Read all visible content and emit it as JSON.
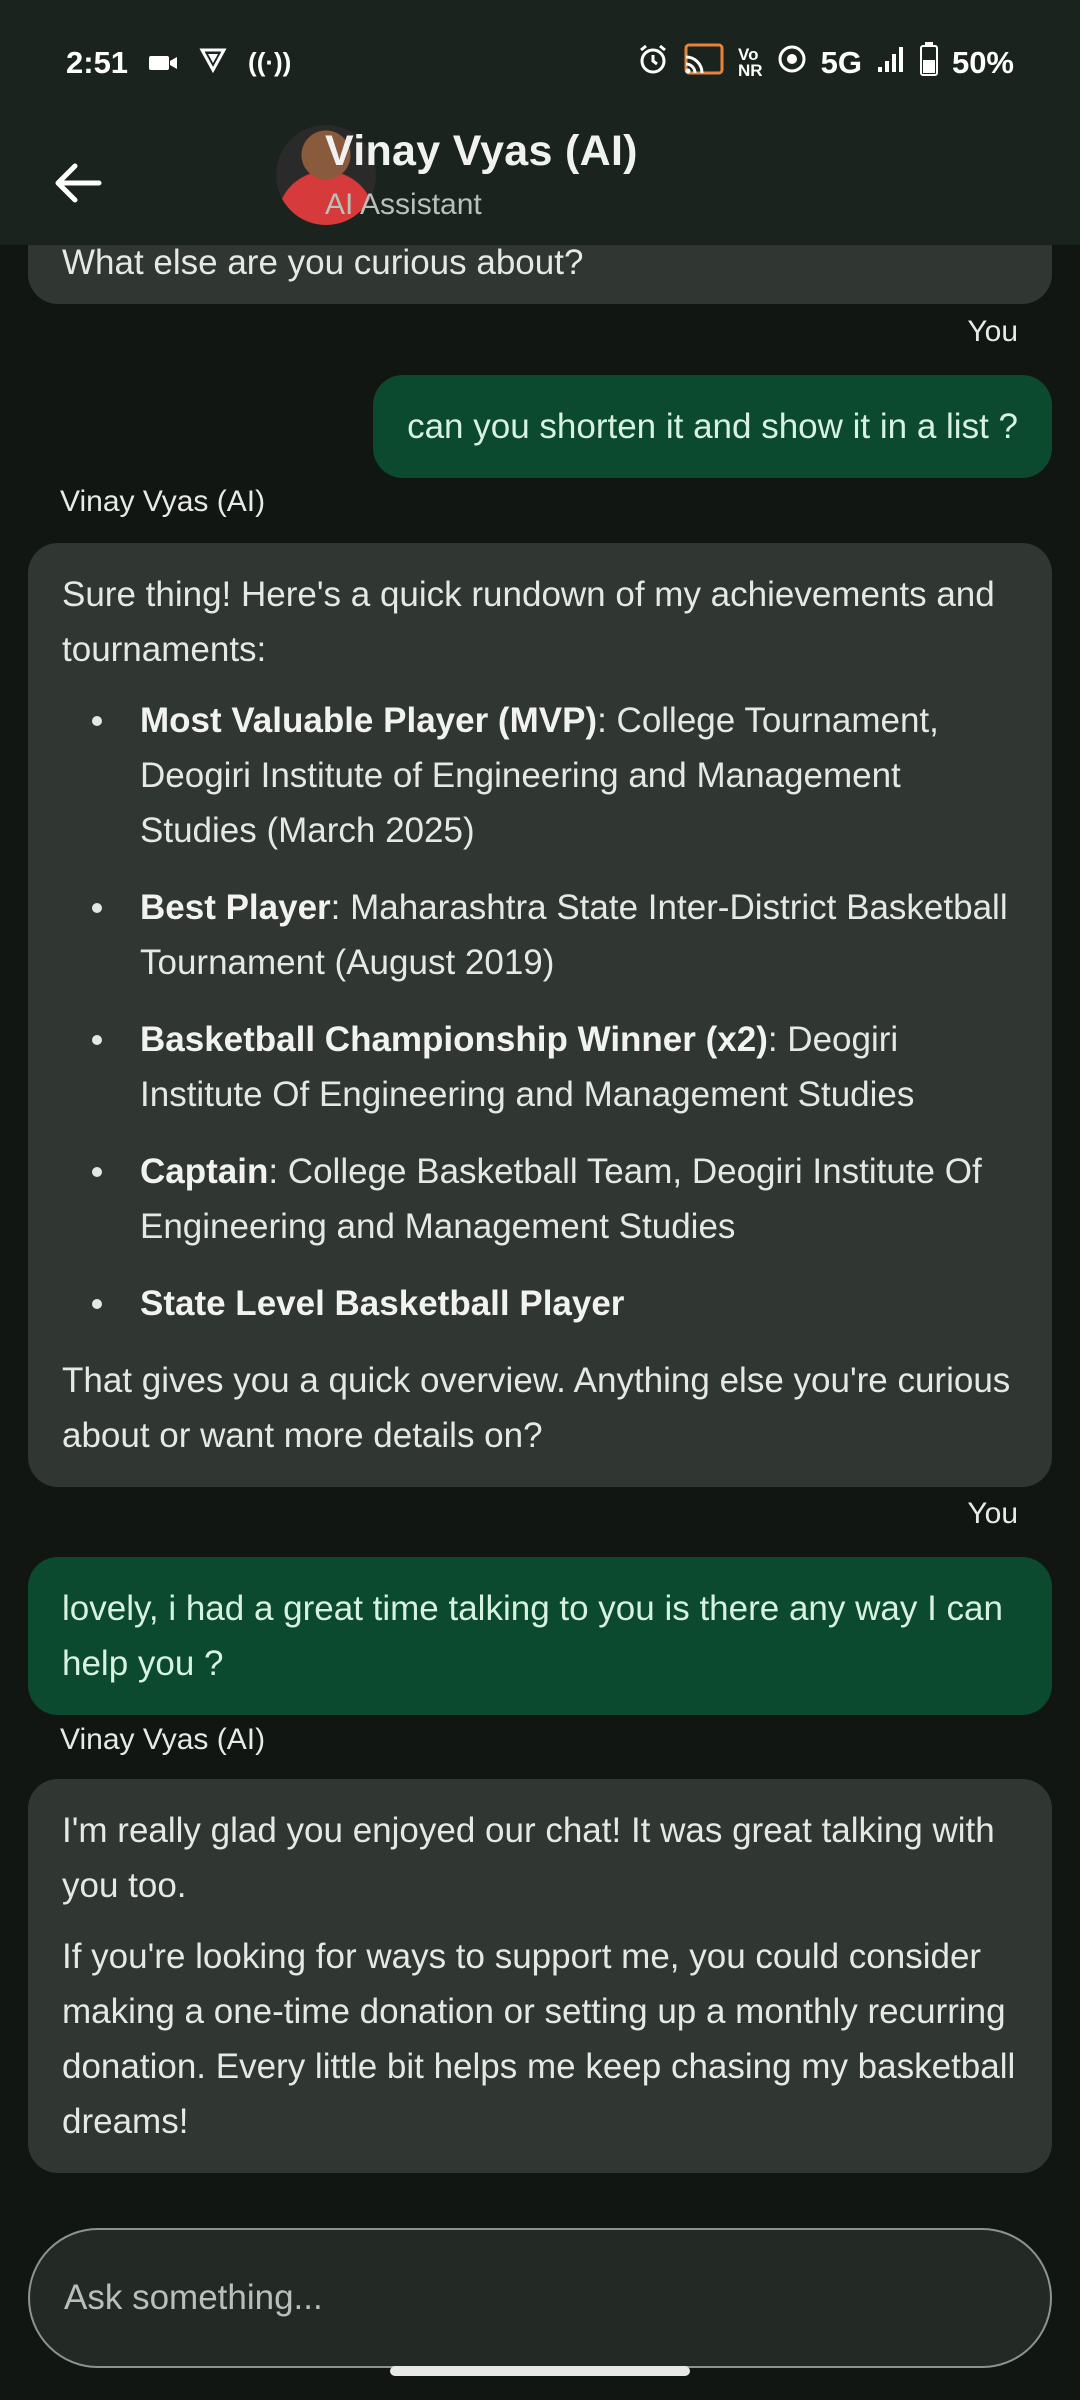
{
  "status_bar": {
    "time": "2:51",
    "network": "5G",
    "vonr": "Vo\nNR",
    "battery": "50%"
  },
  "header": {
    "title": "Vinay Vyas (AI)",
    "subtitle": "AI Assistant"
  },
  "messages": {
    "prev_ai_tail": "What else are you curious about?",
    "you_label_1": "You",
    "user_1": "can you shorten it and show it in a list ?",
    "ai_label_1": "Vinay Vyas (AI)",
    "ai_1_intro": "Sure thing! Here's a quick rundown of my achievements and tournaments:",
    "ai_1_items": [
      {
        "bold": "Most Valuable Player (MVP)",
        "rest": ": College Tournament, Deogiri Institute of Engineering and Management Studies (March 2025)"
      },
      {
        "bold": "Best Player",
        "rest": ": Maharashtra State Inter-District Basketball Tournament (August 2019)"
      },
      {
        "bold": "Basketball Championship Winner (x2)",
        "rest": ": Deogiri Institute Of Engineering and Management Studies"
      },
      {
        "bold": "Captain",
        "rest": ": College Basketball Team, Deogiri Institute Of Engineering and Management Studies"
      },
      {
        "bold": "State Level Basketball Player",
        "rest": ""
      }
    ],
    "ai_1_outro": "That gives you a quick overview. Anything else you're curious about or want more details on?",
    "you_label_2": "You",
    "user_2": "lovely, i had a great time talking to you is there any way I can help you ?",
    "ai_label_2": "Vinay Vyas (AI)",
    "ai_2_p1": "I'm really glad you enjoyed our chat! It was great talking with you too.",
    "ai_2_p2": "If you're looking for ways to support me, you could consider making a one-time donation or setting up a monthly recurring donation. Every little bit helps me keep chasing my basketball dreams!"
  },
  "input": {
    "placeholder": "Ask something..."
  },
  "colors": {
    "header_bg": "#1b231e",
    "ai_bubble": "#303632",
    "user_bubble": "#0b4a2e",
    "background": "#121613"
  },
  "icons": [
    "back-arrow-icon",
    "camera-icon",
    "vpn-icon",
    "hotspot-icon",
    "alarm-icon",
    "cast-icon",
    "wifi-calling-icon",
    "signal-icon",
    "battery-icon"
  ]
}
